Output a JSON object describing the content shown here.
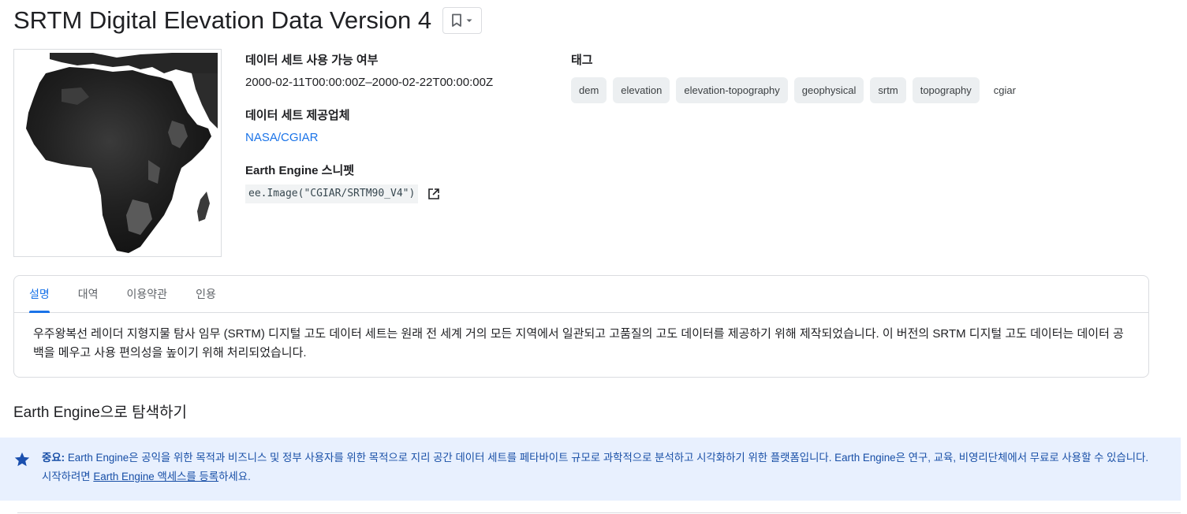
{
  "header": {
    "title": "SRTM Digital Elevation Data Version 4",
    "bookmark_icon": "bookmark-icon",
    "dropdown_icon": "caret-down-icon"
  },
  "meta": {
    "availability_label": "데이터 세트 사용 가능 여부",
    "availability_value": "2000-02-11T00:00:00Z–2000-02-22T00:00:00Z",
    "provider_label": "데이터 세트 제공업체",
    "provider_value": "NASA/CGIAR",
    "snippet_label": "Earth Engine 스니펫",
    "snippet_value": "ee.Image(\"CGIAR/SRTM90_V4\")",
    "snippet_icon": "open-in-new-icon"
  },
  "tags": {
    "label": "태그",
    "chips": [
      "dem",
      "elevation",
      "elevation-topography",
      "geophysical",
      "srtm",
      "topography"
    ],
    "plain": "cgiar"
  },
  "tabs": {
    "items": [
      "설명",
      "대역",
      "이용약관",
      "인용"
    ],
    "active": "설명",
    "description": "우주왕복선 레이더 지형지물 탐사 임무 (SRTM) 디지털 고도 데이터 세트는 원래 전 세계 거의 모든 지역에서 일관되고 고품질의 고도 데이터를 제공하기 위해 제작되었습니다. 이 버전의 SRTM 디지털 고도 데이터는 데이터 공백을 메우고 사용 편의성을 높이기 위해 처리되었습니다."
  },
  "explore": {
    "title": "Earth Engine으로 탐색하기"
  },
  "notice": {
    "icon": "star-icon",
    "bold": "중요:",
    "text1": " Earth Engine은 공익을 위한 목적과 비즈니스 및 정부 사용자를 위한 목적으로 지리 공간 데이터 세트를 페타바이트 규모로 과학적으로 분석하고 시각화하기 위한 플랫폼입니다. Earth Engine은 연구, 교육, 비영리단체에서 무료로 사용할 수 있습니다. 시작하려면 ",
    "link": "Earth Engine 액세스를 등록",
    "text2": "하세요."
  },
  "colors": {
    "accent": "#1a73e8",
    "notice_bg": "#e8f0fe",
    "notice_text": "#174ea6",
    "chip_bg": "#eceff1"
  }
}
